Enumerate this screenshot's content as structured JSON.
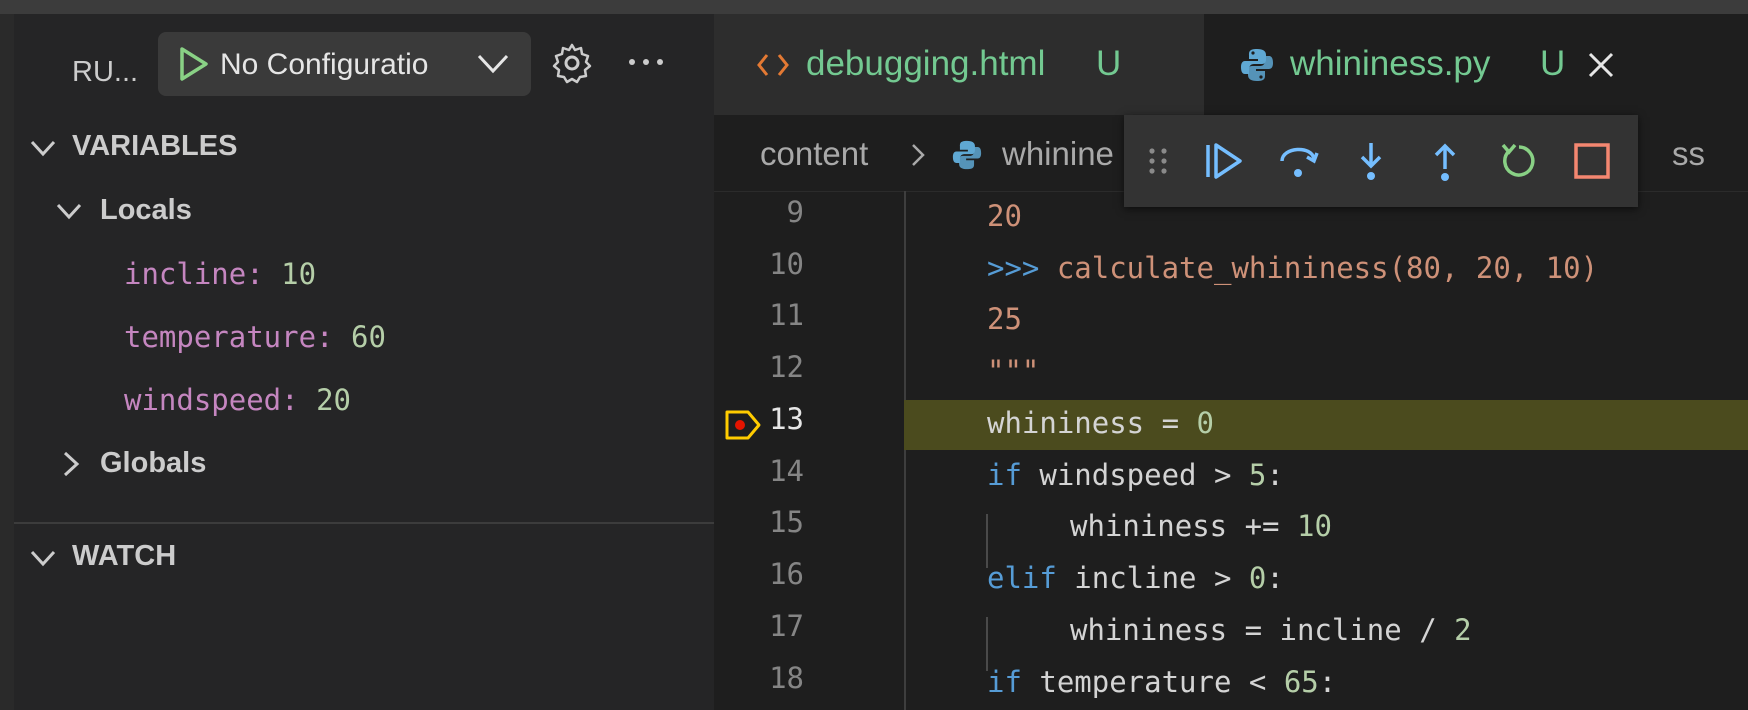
{
  "sidebar": {
    "run_title": "RU...",
    "config_label": "No Configuratio",
    "variables_header": "VARIABLES",
    "locals_label": "Locals",
    "locals": [
      {
        "name": "incline:",
        "value": "10"
      },
      {
        "name": "temperature:",
        "value": "60"
      },
      {
        "name": "windspeed:",
        "value": "20"
      }
    ],
    "globals_label": "Globals",
    "watch_header": "WATCH"
  },
  "tabs": [
    {
      "label": "debugging.html",
      "status": "U",
      "icon": "html-code-icon"
    },
    {
      "label": "whininess.py",
      "status": "U",
      "icon": "python-icon",
      "active": true
    }
  ],
  "breadcrumb": {
    "folder": "content",
    "file_partial": "whinine",
    "symbol_partial": "ss"
  },
  "code": {
    "current_line": 13,
    "lines": [
      {
        "n": "9"
      },
      {
        "n": "10"
      },
      {
        "n": "11"
      },
      {
        "n": "12"
      },
      {
        "n": "13"
      },
      {
        "n": "14"
      },
      {
        "n": "15"
      },
      {
        "n": "16"
      },
      {
        "n": "17"
      },
      {
        "n": "18"
      }
    ],
    "text": {
      "l9": "20",
      "l10_prompt": ">>> ",
      "l10_call": "calculate_whininess(80, 20, 10)",
      "l11": "25",
      "l12": "\"\"\"",
      "l13_a": "whininess = ",
      "l13_b": "0",
      "l14_kw": "if",
      "l14_a": " windspeed > ",
      "l14_num": "5",
      "l14_b": ":",
      "l15_a": "whininess += ",
      "l15_num": "10",
      "l16_kw": "elif",
      "l16_a": " incline > ",
      "l16_num": "0",
      "l16_b": ":",
      "l17_a": "whininess = incline / ",
      "l17_num": "2",
      "l18_kw": "if",
      "l18_a": " temperature < ",
      "l18_num": "65",
      "l18_b": ":"
    }
  },
  "colors": {
    "accent_green": "#73c991",
    "breakpoint_yellow": "#ffcc00",
    "highlight": "#4b4b1e"
  }
}
